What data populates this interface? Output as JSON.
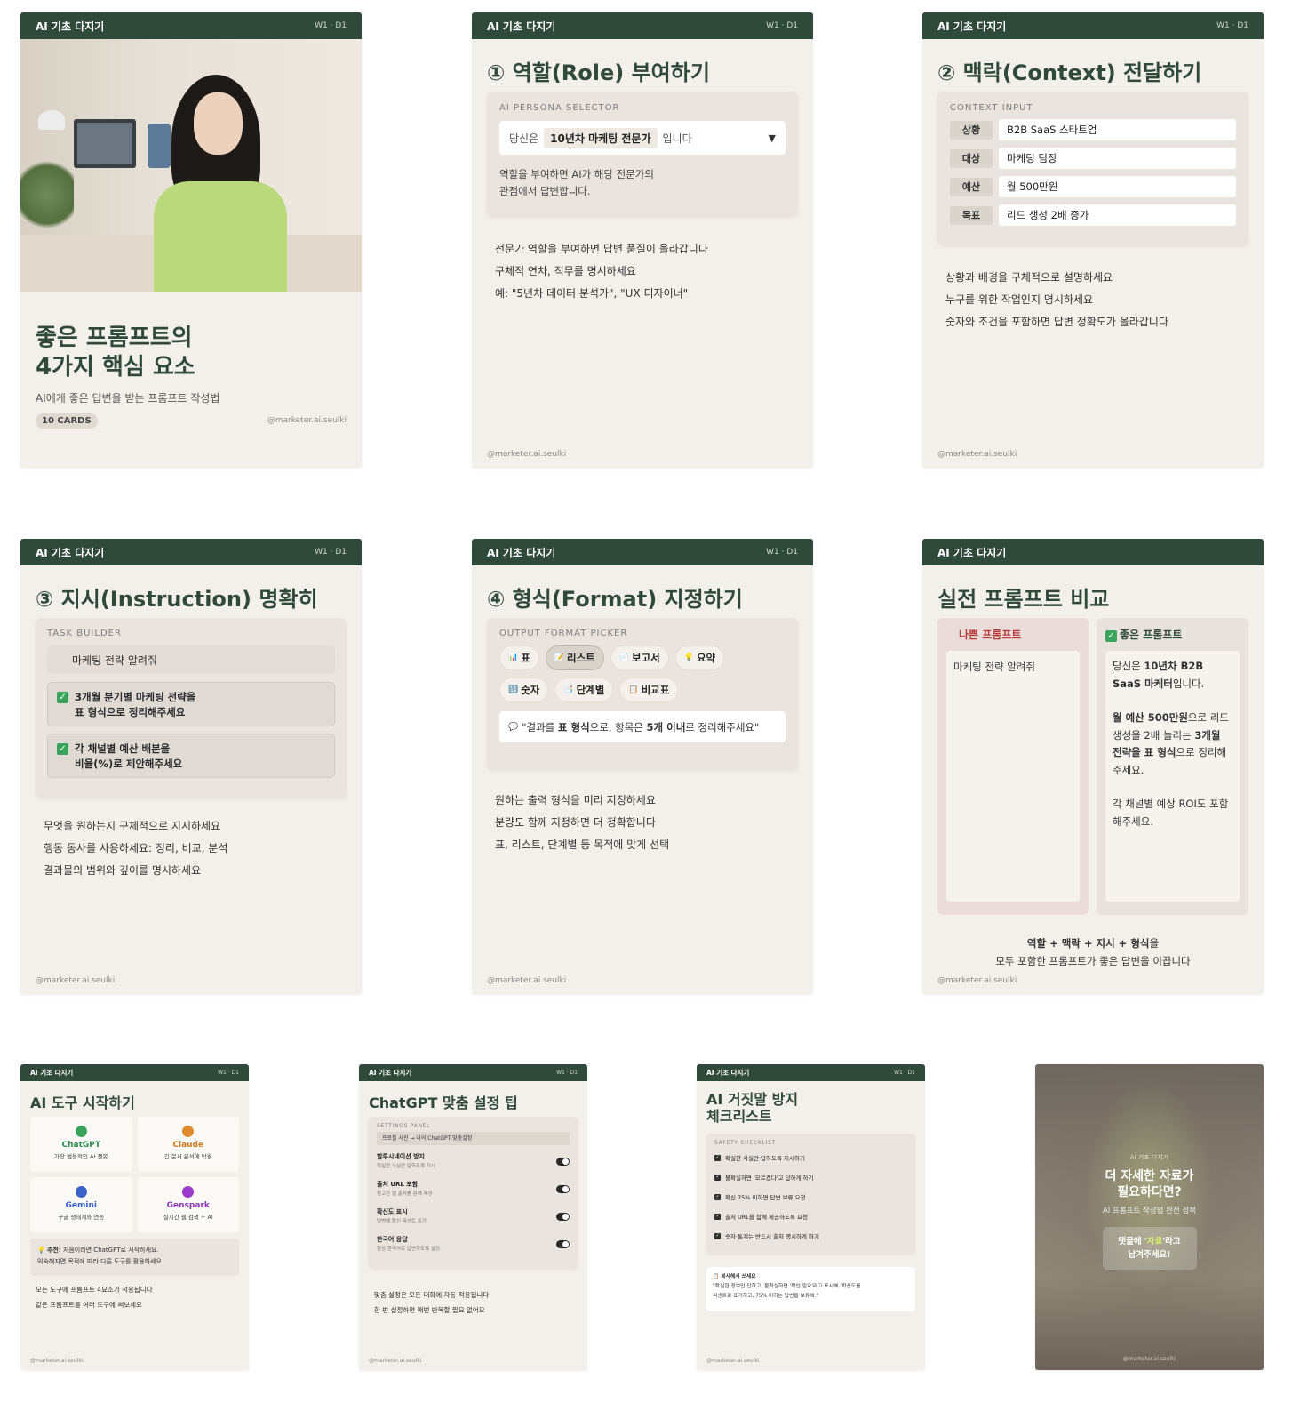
{
  "common": {
    "series": "AI 기초 다지기",
    "week": "W1 · D1",
    "handle": "@marketer.ai.seulki"
  },
  "colors": {
    "brand": "#2f4a3a",
    "background": "#f3efea",
    "bad": "#b83a3a",
    "check": "#3aa35c"
  },
  "card1": {
    "title_line1": "좋은 프롬프트의",
    "title_line2": "4가지 핵심 요소",
    "subtitle": "AI에게 좋은 답변을 받는 프롬프트 작성법",
    "badge": "10 CARDS"
  },
  "card2": {
    "title": "① 역할(Role) 부여하기",
    "panel_label": "AI PERSONA SELECTOR",
    "select_prefix": "당신은",
    "select_value": "10년차 마케팅 전문가",
    "select_suffix": "입니다",
    "note_line1": "역할을 부여하면 AI가 해당 전문가의",
    "note_line2": "관점에서 답변합니다.",
    "tips": [
      "전문가 역할을 부여하면 답변 품질이 올라갑니다",
      "구체적 연차, 직무를 명시하세요",
      "예: \"5년차 데이터 분석가\", \"UX 디자이너\""
    ]
  },
  "card3": {
    "title": "② 맥락(Context) 전달하기",
    "panel_label": "CONTEXT INPUT",
    "fields": [
      {
        "label": "상황",
        "value": "B2B SaaS 스타트업"
      },
      {
        "label": "대상",
        "value": "마케팅 팀장"
      },
      {
        "label": "예산",
        "value": "월 500만원"
      },
      {
        "label": "목표",
        "value": "리드 생성 2배 증가"
      }
    ],
    "tips": [
      "상황과 배경을 구체적으로 설명하세요",
      "누구를 위한 작업인지 명시하세요",
      "숫자와 조건을 포함하면 답변 정확도가 올라갑니다"
    ]
  },
  "card4": {
    "title": "③ 지시(Instruction) 명확히",
    "panel_label": "TASK BUILDER",
    "vague": "마케팅 전략 알려줘",
    "items": [
      {
        "line1": "3개월 분기별 마케팅 전략을",
        "line2": "표 형식으로 정리해주세요"
      },
      {
        "line1": "각 채널별 예산 배분을",
        "line2": "비율(%)로 제안해주세요"
      }
    ],
    "tips": [
      "무엇을 원하는지 구체적으로 지시하세요",
      "행동 동사를 사용하세요: 정리, 비교, 분석",
      "결과물의 범위와 깊이를 명시하세요"
    ]
  },
  "card5": {
    "title": "④ 형식(Format) 지정하기",
    "panel_label": "OUTPUT FORMAT PICKER",
    "chips_row1": [
      {
        "icon": "📊",
        "label": "표"
      },
      {
        "icon": "📝",
        "label": "리스트"
      },
      {
        "icon": "📄",
        "label": "보고서"
      },
      {
        "icon": "💡",
        "label": "요약"
      }
    ],
    "chips_row2": [
      {
        "icon": "🔢",
        "label": "숫자"
      },
      {
        "icon": "📑",
        "label": "단계별"
      },
      {
        "icon": "📋",
        "label": "비교표"
      }
    ],
    "selected_chip": "리스트",
    "quote_icon": "💬",
    "quote_a": "\"결과를",
    "quote_b": "표 형식",
    "quote_c": "으로, 항목은",
    "quote_d": "5개 이내",
    "quote_e": "로 정리해주세요\"",
    "tips": [
      "원하는 출력 형식을 미리 지정하세요",
      "분량도 함께 지정하면 더 정확합니다",
      "표, 리스트, 단계별 등 목적에 맞게 선택"
    ]
  },
  "card6": {
    "title": "실전 프롬프트 비교",
    "bad_icon": "❌",
    "bad_header": "나쁜 프롬프트",
    "bad_text": "마케팅 전략 알려줘",
    "good_icon": "✅",
    "good_header": "좋은 프롬프트",
    "good_p1_a": "당신은",
    "good_p1_b": "10년차 B2B SaaS 마케터",
    "good_p1_c": "입니다.",
    "good_p2_a": "월 예산 500만원",
    "good_p2_b": "으로 리드 생성을 2배 늘리는",
    "good_p2_c": "3개월 전략을 표 형식",
    "good_p2_d": "으로 정리해주세요.",
    "good_p3": "각 채널별 예상 ROI도 포함해주세요.",
    "footer_line1": "역할 + 맥락 + 지시 + 형식",
    "footer_line1_suffix": "을",
    "footer_line2": "모두 포함한 프롬프트가 좋은 답변을 이끕니다"
  },
  "card7": {
    "title": "AI 도구 시작하기",
    "tools": [
      {
        "name": "ChatGPT",
        "desc": "가장 범용적인 AI 챗봇",
        "color": "#3aa35c",
        "text_color": "#2e8b57"
      },
      {
        "name": "Claude",
        "desc": "긴 문서 분석에 탁월",
        "color": "#e08a2e",
        "text_color": "#d07a20"
      },
      {
        "name": "Gemini",
        "desc": "구글 생태계와 연동",
        "color": "#3a62c8",
        "text_color": "#3a62c8"
      },
      {
        "name": "Genspark",
        "desc": "실시간 웹 검색 + AI",
        "color": "#9a3ac8",
        "text_color": "#8a3ab8"
      }
    ],
    "tip_icon": "💡",
    "tip_bold": "추천:",
    "tip_text1": "처음이라면 ChatGPT로 시작하세요.",
    "tip_text2": "익숙해지면 목적에 따라 다른 도구를 활용하세요.",
    "tips": [
      "모든 도구에 프롬프트 4요소가 적용됩니다",
      "같은 프롬프트를 여러 도구에 써보세요"
    ]
  },
  "card8": {
    "title": "ChatGPT 맞춤 설정 팁",
    "panel_label": "SETTINGS PANEL",
    "path": "프로필 사진 → 나의 ChatGPT 맞춤설정",
    "settings": [
      {
        "name": "할루시네이션 방지",
        "desc": "확실한 사실만 답하도록 지시"
      },
      {
        "name": "출처 URL 포함",
        "desc": "참고한 웹 출처를 함께 제공"
      },
      {
        "name": "확신도 표시",
        "desc": "답변에 확신 퍼센트 표기"
      },
      {
        "name": "한국어 응답",
        "desc": "항상 한국어로 답변하도록 설정"
      }
    ],
    "tips": [
      "맞춤 설정은 모든 대화에 자동 적용됩니다",
      "한 번 설정하면 매번 반복할 필요 없어요"
    ]
  },
  "card9": {
    "title_line1": "AI 거짓말 방지",
    "title_line2": "체크리스트",
    "panel_label": "SAFETY CHECKLIST",
    "checks": [
      "확실한 사실만 답하도록 지시하기",
      "불확실하면 '모르겠다'고 답하게 하기",
      "확신 75% 이하면 답변 보류 요청",
      "출처 URL을 함께 제공하도록 요청",
      "숫자·통계는 반드시 출처 명시하게 하기"
    ],
    "copy_icon": "📋",
    "copy_title": "복사해서 쓰세요",
    "copy_line1": "\"확실한 정보만 답하고, 불확실하면 '확인 필요'라고 표시해. 확신도를",
    "copy_line2": "퍼센트로 표기하고, 75% 이하는 답변을 보류해.\""
  },
  "card10": {
    "small": "AI 기초 다지기",
    "title_line1": "더 자세한 자료가",
    "title_line2": "필요하다면?",
    "subtitle": "AI 프롬프트 작성법 완전 정복",
    "cta_a": "댓글에 '",
    "cta_b": "자료",
    "cta_c": "'라고",
    "cta_line2": "남겨주세요!"
  }
}
